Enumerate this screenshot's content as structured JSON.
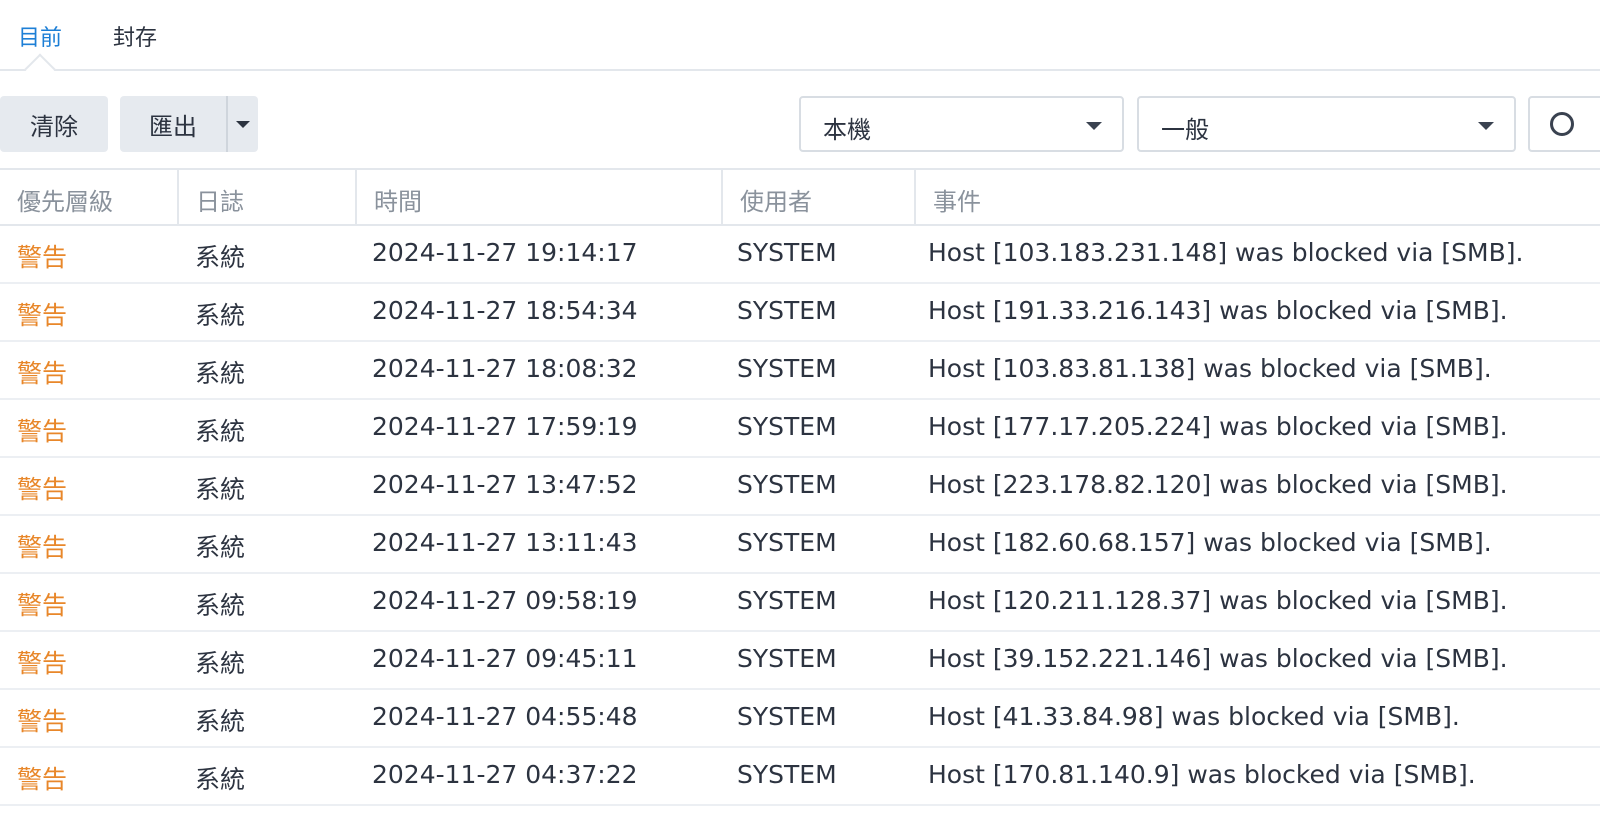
{
  "tabs": [
    {
      "label": "目前",
      "active": true
    },
    {
      "label": "封存",
      "active": false
    }
  ],
  "toolbar": {
    "clear_label": "清除",
    "export_label": "匯出",
    "source_select": "本機",
    "type_select": "一般"
  },
  "colors": {
    "accent": "#1d7fd6",
    "warning": "#e8872a",
    "button_bg": "#e6eaef"
  },
  "table": {
    "columns": [
      "優先層級",
      "日誌",
      "時間",
      "使用者",
      "事件"
    ],
    "rows": [
      {
        "level": "警告",
        "log": "系統",
        "time": "2024-11-27 19:14:17",
        "user": "SYSTEM",
        "event": "Host [103.183.231.148] was blocked via [SMB]."
      },
      {
        "level": "警告",
        "log": "系統",
        "time": "2024-11-27 18:54:34",
        "user": "SYSTEM",
        "event": "Host [191.33.216.143] was blocked via [SMB]."
      },
      {
        "level": "警告",
        "log": "系統",
        "time": "2024-11-27 18:08:32",
        "user": "SYSTEM",
        "event": "Host [103.83.81.138] was blocked via [SMB]."
      },
      {
        "level": "警告",
        "log": "系統",
        "time": "2024-11-27 17:59:19",
        "user": "SYSTEM",
        "event": "Host [177.17.205.224] was blocked via [SMB]."
      },
      {
        "level": "警告",
        "log": "系統",
        "time": "2024-11-27 13:47:52",
        "user": "SYSTEM",
        "event": "Host [223.178.82.120] was blocked via [SMB]."
      },
      {
        "level": "警告",
        "log": "系統",
        "time": "2024-11-27 13:11:43",
        "user": "SYSTEM",
        "event": "Host [182.60.68.157] was blocked via [SMB]."
      },
      {
        "level": "警告",
        "log": "系統",
        "time": "2024-11-27 09:58:19",
        "user": "SYSTEM",
        "event": "Host [120.211.128.37] was blocked via [SMB]."
      },
      {
        "level": "警告",
        "log": "系統",
        "time": "2024-11-27 09:45:11",
        "user": "SYSTEM",
        "event": "Host [39.152.221.146] was blocked via [SMB]."
      },
      {
        "level": "警告",
        "log": "系統",
        "time": "2024-11-27 04:55:48",
        "user": "SYSTEM",
        "event": "Host [41.33.84.98] was blocked via [SMB]."
      },
      {
        "level": "警告",
        "log": "系統",
        "time": "2024-11-27 04:37:22",
        "user": "SYSTEM",
        "event": "Host [170.81.140.9] was blocked via [SMB]."
      }
    ]
  }
}
